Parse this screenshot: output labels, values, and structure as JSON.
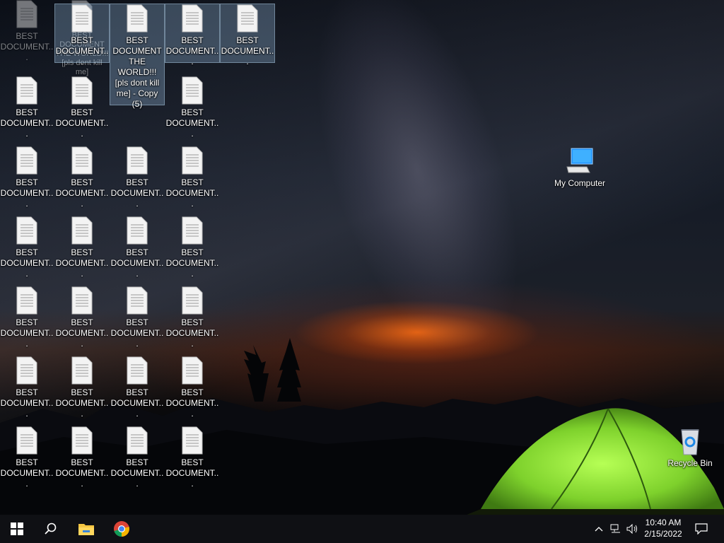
{
  "desktop": {
    "doc_label": "BEST DOCUMENT...",
    "dragged_label": "BEST DOCUMENT THE WORLD!!! [pls dont kill me] - Copy (5)",
    "ghost_label_a": "BEST DOCUMENT...",
    "ghost_label_b": "BEST DOCUMENT THE WORLD!!! [pls dont kill me]",
    "my_computer": "My Computer",
    "recycle_bin": "Recycle Bin"
  },
  "taskbar": {
    "start_icon": "windows-logo",
    "search_icon": "search-icon",
    "explorer_icon": "folder-icon",
    "chrome_icon": "chrome-icon",
    "time": "10:40 AM",
    "date": "2/15/2022"
  },
  "colors": {
    "tent": "#8fe03a",
    "glow": "#ff6a14",
    "taskbar": "#0f1014",
    "selection": "#add8ff"
  }
}
